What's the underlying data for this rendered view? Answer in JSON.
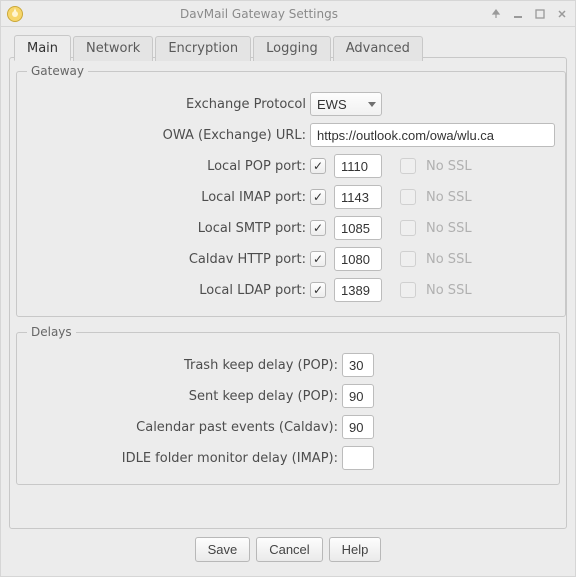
{
  "window_title": "DavMail Gateway Settings",
  "tabs": {
    "main": "Main",
    "network": "Network",
    "encryption": "Encryption",
    "logging": "Logging",
    "advanced": "Advanced"
  },
  "gateway": {
    "legend": "Gateway",
    "exchange_protocol_label": "Exchange Protocol",
    "exchange_protocol_value": "EWS",
    "owa_url_label": "OWA (Exchange) URL:",
    "owa_url_value": "https://outlook.com/owa/wlu.ca",
    "no_ssl_label": "No SSL",
    "ports": {
      "pop": {
        "label": "Local POP port:",
        "enabled": true,
        "value": "1110"
      },
      "imap": {
        "label": "Local IMAP port:",
        "enabled": true,
        "value": "1143"
      },
      "smtp": {
        "label": "Local SMTP port:",
        "enabled": true,
        "value": "1085"
      },
      "caldav": {
        "label": "Caldav HTTP port:",
        "enabled": true,
        "value": "1080"
      },
      "ldap": {
        "label": "Local LDAP port:",
        "enabled": true,
        "value": "1389"
      }
    }
  },
  "delays": {
    "legend": "Delays",
    "trash_label": "Trash keep delay (POP):",
    "trash_value": "30",
    "sent_label": "Sent keep delay (POP):",
    "sent_value": "90",
    "caldav_label": "Calendar past events (Caldav):",
    "caldav_value": "90",
    "idle_label": "IDLE folder monitor delay (IMAP):",
    "idle_value": ""
  },
  "buttons": {
    "save": "Save",
    "cancel": "Cancel",
    "help": "Help"
  }
}
